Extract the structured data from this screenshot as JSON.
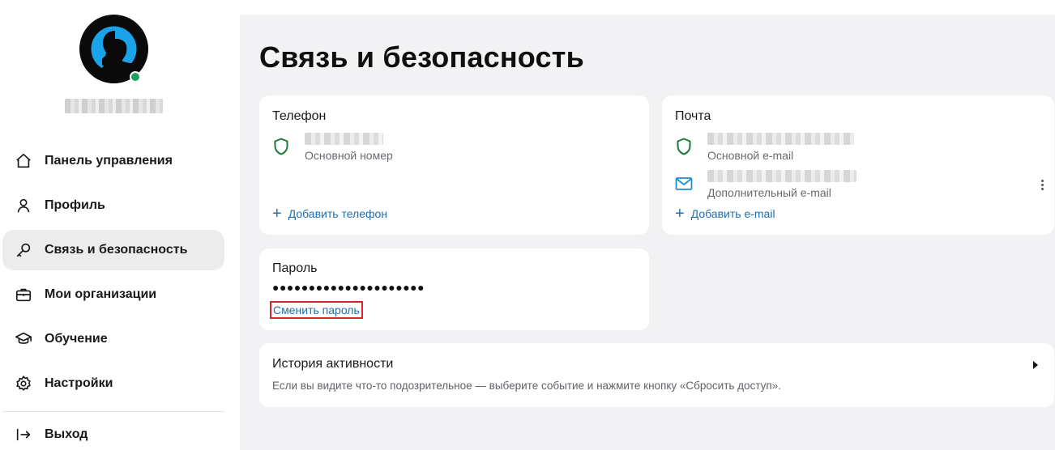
{
  "sidebar": {
    "nav": [
      {
        "label": "Панель управления",
        "icon": "home-icon"
      },
      {
        "label": "Профиль",
        "icon": "user-icon"
      },
      {
        "label": "Связь и безопасность",
        "icon": "key-icon",
        "active": true
      },
      {
        "label": "Мои организации",
        "icon": "briefcase-icon"
      },
      {
        "label": "Обучение",
        "icon": "graduation-cap-icon"
      },
      {
        "label": "Настройки",
        "icon": "gear-icon"
      }
    ],
    "logout": {
      "label": "Выход",
      "icon": "logout-icon"
    }
  },
  "page": {
    "title": "Связь и безопасность"
  },
  "phone_card": {
    "title": "Телефон",
    "primary_sub": "Основной номер",
    "add_label": "Добавить телефон"
  },
  "mail_card": {
    "title": "Почта",
    "primary_sub": "Основной e-mail",
    "secondary_sub": "Дополнительный e-mail",
    "add_label": "Добавить e-mail"
  },
  "password_card": {
    "title": "Пароль",
    "masked": "●●●●●●●●●●●●●●●●●●●●●",
    "change_label": "Сменить пароль"
  },
  "history_card": {
    "title": "История активности",
    "description": "Если вы видите что-то подозрительное — выберите событие и нажмите кнопку «Сбросить доступ»."
  },
  "colors": {
    "accent_link": "#1f6fb0",
    "shield": "#1d7a3d",
    "online": "#1fa05a",
    "highlight_border": "#d9232d",
    "avatar_blue": "#1aa3e8"
  }
}
